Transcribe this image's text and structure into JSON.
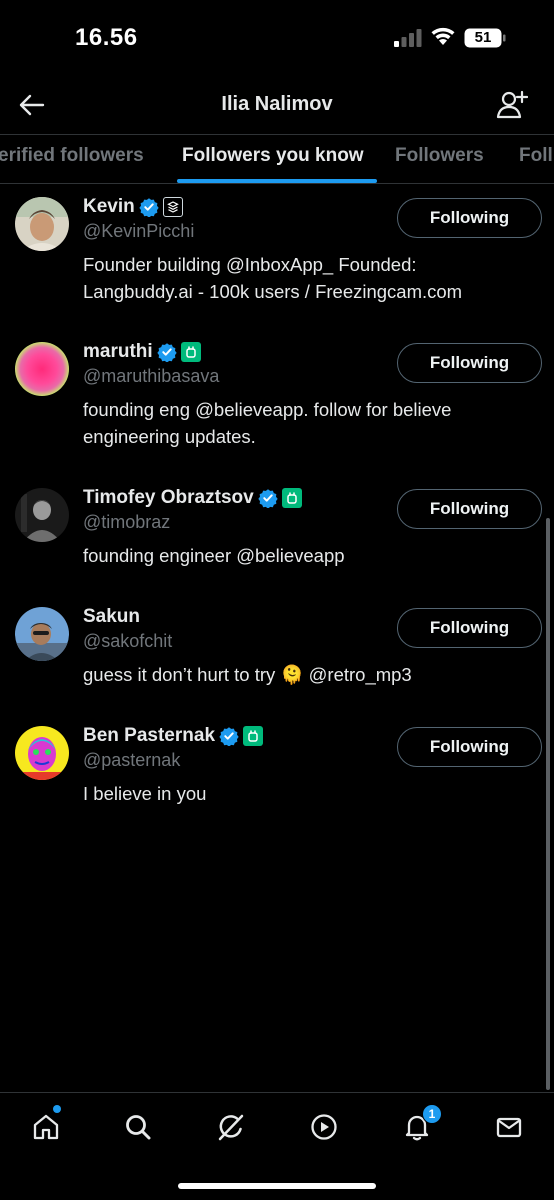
{
  "status_bar": {
    "time": "16.56",
    "battery": "51"
  },
  "header": {
    "title": "Ilia Nalimov",
    "back_icon": "back-arrow-icon",
    "add_icon": "add-user-icon"
  },
  "tabs": [
    {
      "label": "erified followers"
    },
    {
      "label": "Followers you know",
      "active": true
    },
    {
      "label": "Followers"
    },
    {
      "label": "Foll"
    }
  ],
  "users": [
    {
      "name": "Kevin",
      "handle": "@KevinPicchi",
      "bio": "Founder building @InboxApp_ Founded: Langbuddy.ai - 100k users / Freezingcam.com",
      "button": "Following"
    },
    {
      "name": "maruthi",
      "handle": "@maruthibasava",
      "bio": "founding eng @believeapp. follow for believe engineering updates.",
      "button": "Following"
    },
    {
      "name": "Timofey Obraztsov",
      "handle": "@timobraz",
      "bio": "founding engineer @believeapp",
      "button": "Following"
    },
    {
      "name": "Sakun",
      "handle": "@sakofchit",
      "bio_before": "guess it don’t hurt to try",
      "bio_emoji": "🫠",
      "bio_after": "@retro_mp3",
      "button": "Following"
    },
    {
      "name": "Ben Pasternak",
      "handle": "@pasternak",
      "bio": "I believe in you",
      "button": "Following"
    }
  ],
  "bottom_nav": {
    "items": [
      "home-icon",
      "search-icon",
      "grok-icon",
      "video-icon",
      "notifications-icon",
      "messages-icon"
    ],
    "notification_count": "1"
  },
  "colors": {
    "accent": "#1d9bf0",
    "verified": "#1d9bf0",
    "affiliate_green": "#00ba7c",
    "secondary_text": "#71767b"
  }
}
